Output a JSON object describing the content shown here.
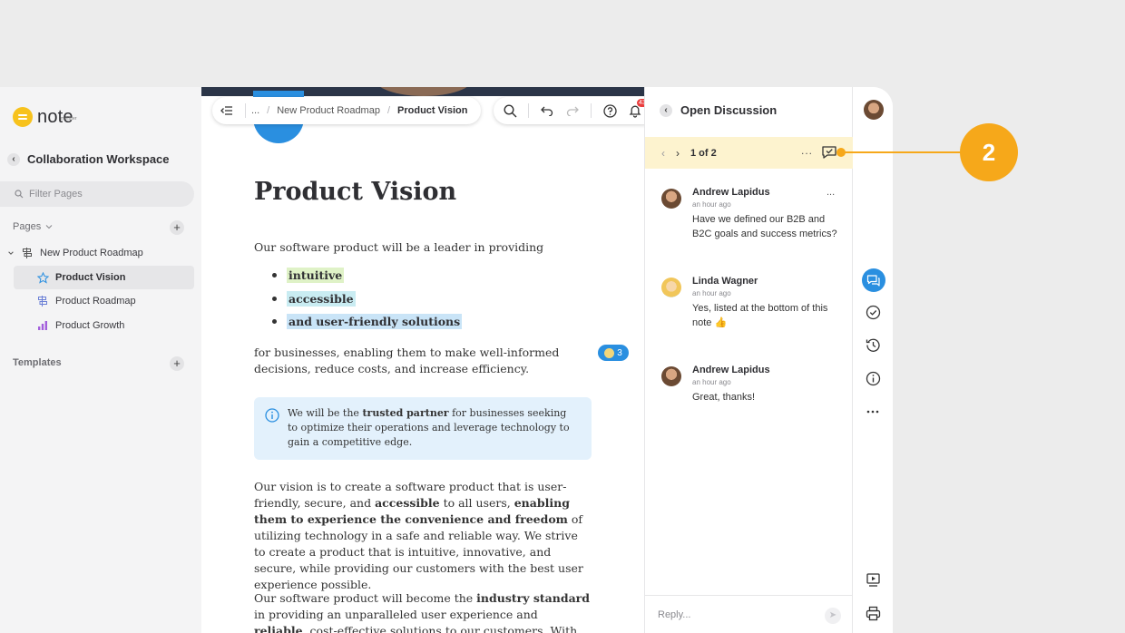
{
  "app": {
    "logo_small": "meister",
    "logo_text": "note"
  },
  "sidebar": {
    "workspace": "Collaboration Workspace",
    "filter_placeholder": "Filter Pages",
    "pages_header": "Pages",
    "tree": [
      {
        "label": "New Product Roadmap",
        "icon": "roadmap-icon"
      },
      {
        "label": "Product Vision",
        "icon": "star-icon",
        "active": true
      },
      {
        "label": "Product Roadmap",
        "icon": "roadmap-icon"
      },
      {
        "label": "Product Growth",
        "icon": "bar-chart-icon"
      }
    ],
    "templates_header": "Templates"
  },
  "toolbar": {
    "ellipsis": "...",
    "breadcrumb_parent": "New Product Roadmap",
    "breadcrumb_current": "Product Vision",
    "notification_count": "43"
  },
  "doc": {
    "title": "Product Vision",
    "intro": "Our software product will be a leader in providing",
    "bullets": [
      "intuitive",
      "accessible",
      "and user-friendly solutions"
    ],
    "bullet_colors": [
      "#dff2c7",
      "#c9ecf2",
      "#c9e4f7"
    ],
    "para1": "for businesses, enabling them to make well-informed decisions, reduce costs, and increase efficiency.",
    "comment_count": "3",
    "callout": {
      "pre": "We will be the ",
      "bold": "trusted partner",
      "post": " for businesses seeking to optimize their operations and leverage technology to gain a competitive edge."
    },
    "para2": {
      "t1": "Our vision is to create a software product that is user-friendly, secure, and ",
      "b1": "accessible",
      "t2": " to all users, ",
      "b2": "enabling them to experience the convenience and freedom",
      "t3": " of utilizing technology in a safe and reliable way. We strive to create a product that is intuitive, innovative, and secure, while providing our customers with the best user experience possible."
    },
    "para3": {
      "t1": "Our software product will become the ",
      "b1": "industry standard",
      "t2": " in providing an unparalleled user experience and ",
      "b2": "reliable",
      "t3": ", cost-effective solutions to our customers. With our innovative"
    }
  },
  "discussion": {
    "title": "Open Discussion",
    "counter": "1 of 2",
    "more": "...",
    "comments": [
      {
        "name": "Andrew Lapidus",
        "time": "an hour ago",
        "text": "Have we defined our B2B and B2C goals and success metrics?"
      },
      {
        "name": "Linda Wagner",
        "time": "an hour ago",
        "text": "Yes, listed at the bottom of this note 👍"
      },
      {
        "name": "Andrew Lapidus",
        "time": "an hour ago",
        "text": "Great, thanks!"
      }
    ],
    "reply_placeholder": "Reply..."
  },
  "step": {
    "number": "2",
    "color": "#f6a81a"
  },
  "colors": {
    "accent": "#2a8fe0",
    "highlight_bar": "#fdf3cf",
    "callout_bg": "#e3f1fc"
  }
}
